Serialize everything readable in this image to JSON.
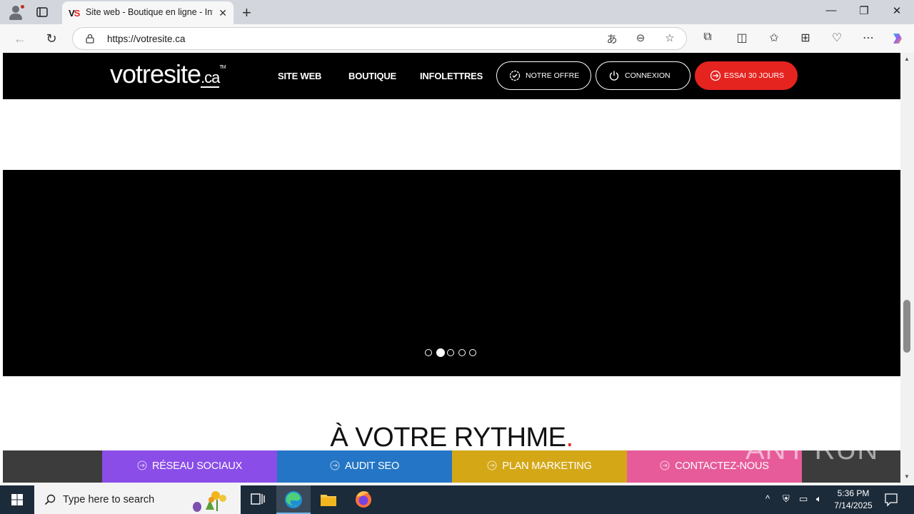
{
  "browser": {
    "tab_title": "Site web - Boutique en ligne - Info",
    "tab_favicon": "VS",
    "url": "https://votresite.ca"
  },
  "site": {
    "logo_text": "votresite",
    "logo_suffix": ".ca",
    "logo_tm": "TM",
    "nav": [
      "SITE WEB",
      "BOUTIQUE",
      "INFOLETTRES"
    ],
    "btn_offer": "NOTRE OFFRE",
    "btn_login": "CONNEXION",
    "btn_trial": "ESSAI 30 JOURS",
    "heading": "À VOTRE RYTHME",
    "heading_mark": "."
  },
  "slider": {
    "slide_count": 5,
    "active_slide": 2
  },
  "bottom_bar": [
    {
      "label": "RÉSEAU SOCIAUX",
      "color": "#8a4de8"
    },
    {
      "label": "AUDIT SEO",
      "color": "#2475c5"
    },
    {
      "label": "PLAN MARKETING",
      "color": "#d4a717"
    },
    {
      "label": "CONTACTEZ-NOUS",
      "color": "#e75b9a"
    }
  ],
  "watermark": "ANY RUN",
  "taskbar": {
    "search_placeholder": "Type here to search",
    "time": "5:36 PM",
    "date": "7/14/2025"
  },
  "colors": {
    "brand_red": "#e52420",
    "header_bg": "#000000"
  }
}
